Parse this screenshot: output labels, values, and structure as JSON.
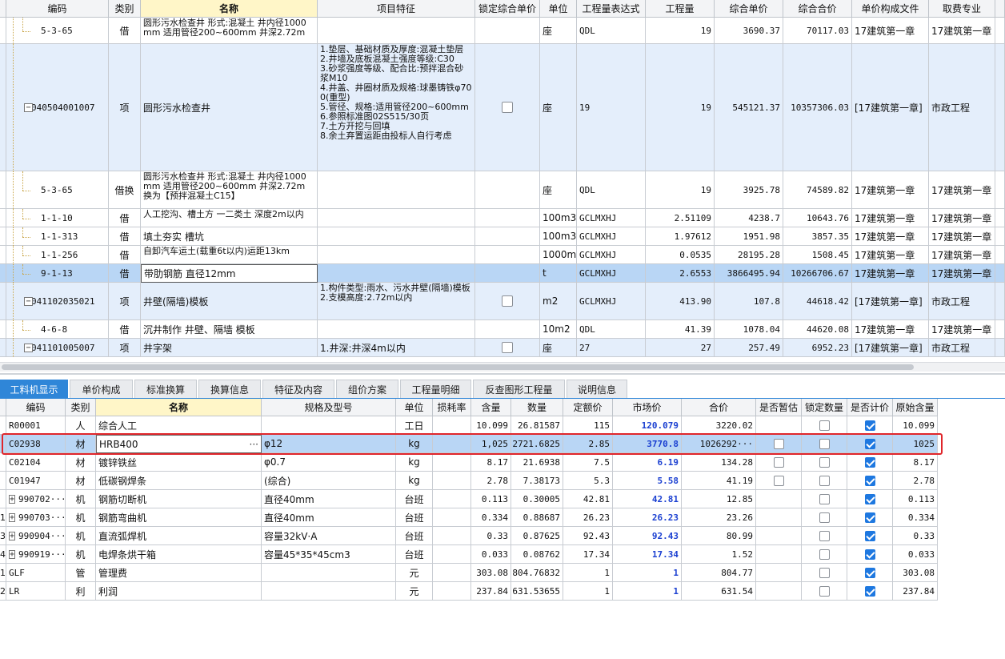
{
  "top_table": {
    "columns": [
      "编码",
      "类别",
      "名称",
      "项目特征",
      "锁定综合单价",
      "单位",
      "工程量表达式",
      "工程量",
      "综合单价",
      "综合合价",
      "单价构成文件",
      "取费专业"
    ],
    "rows": [
      {
        "code": "5-3-65",
        "type": "借",
        "name": "圆形污水检查井 形式:混凝土 井内径1000mm 适用管径200~600mm 井深2.72m",
        "feature": "",
        "lock": "",
        "unit": "座",
        "expr": "QDL",
        "qty": "19",
        "price": "3690.37",
        "total": "70117.03",
        "file": "17建筑第一章",
        "major": "17建筑第一章"
      },
      {
        "code": "040504001007",
        "type": "项",
        "name": "圆形污水检查井",
        "feature": "1.垫层、基础材质及厚度:混凝土垫层\n2.井墙及底板混凝土强度等级:C30\n3.砂浆强度等级、配合比:预拌混合砂浆M10\n4.井盖、井圈材质及规格:球墨铸铁φ700(重型)\n5.管径、规格:适用管径200~600mm\n6.参照标准图02S515/30页\n7.土方开挖与回填\n8.余土弃置运距由投标人自行考虑",
        "lock": "unchecked",
        "unit": "座",
        "expr": "19",
        "qty": "19",
        "price": "545121.37",
        "total": "10357306.03",
        "file": "[17建筑第一章]",
        "major": "市政工程"
      },
      {
        "code": "5-3-65",
        "type": "借换",
        "name": "圆形污水检查井 形式:混凝土 井内径1000mm 适用管径200~600mm 井深2.72m 换为【预拌混凝土C15】",
        "feature": "",
        "lock": "",
        "unit": "座",
        "expr": "QDL",
        "qty": "19",
        "price": "3925.78",
        "total": "74589.82",
        "file": "17建筑第一章",
        "major": "17建筑第一章"
      },
      {
        "code": "1-1-10",
        "type": "借",
        "name": "人工挖沟、槽土方 一二类土 深度2m以内",
        "feature": "",
        "lock": "",
        "unit": "100m3",
        "expr": "GCLMXHJ",
        "qty": "2.51109",
        "price": "4238.7",
        "total": "10643.76",
        "file": "17建筑第一章",
        "major": "17建筑第一章"
      },
      {
        "code": "1-1-313",
        "type": "借",
        "name": "填土夯实 槽坑",
        "feature": "",
        "lock": "",
        "unit": "100m3",
        "expr": "GCLMXHJ",
        "qty": "1.97612",
        "price": "1951.98",
        "total": "3857.35",
        "file": "17建筑第一章",
        "major": "17建筑第一章"
      },
      {
        "code": "1-1-256",
        "type": "借",
        "name": "自卸汽车运土(载重6t以内)运距13km",
        "feature": "",
        "lock": "",
        "unit": "1000m3",
        "expr": "GCLMXHJ",
        "qty": "0.0535",
        "price": "28195.28",
        "total": "1508.45",
        "file": "17建筑第一章",
        "major": "17建筑第一章"
      },
      {
        "code": "9-1-13",
        "type": "借",
        "name": "带肋钢筋 直径12mm",
        "feature": "",
        "lock": "",
        "unit": "t",
        "expr": "GCLMXHJ",
        "qty": "2.6553",
        "price": "3866495.94",
        "total": "10266706.67",
        "file": "17建筑第一章",
        "major": "17建筑第一章"
      },
      {
        "code": "041102035021",
        "type": "项",
        "name": "井壁(隔墙)模板",
        "feature": "1.构件类型:雨水、污水井壁(隔墙)模板\n2.支模高度:2.72m以内",
        "lock": "unchecked",
        "unit": "m2",
        "expr": "GCLMXHJ",
        "qty": "413.90",
        "price": "107.8",
        "total": "44618.42",
        "file": "[17建筑第一章]",
        "major": "市政工程"
      },
      {
        "code": "4-6-8",
        "type": "借",
        "name": "沉井制作 井壁、隔墙 模板",
        "feature": "",
        "lock": "",
        "unit": "10m2",
        "expr": "QDL",
        "qty": "41.39",
        "price": "1078.04",
        "total": "44620.08",
        "file": "17建筑第一章",
        "major": "17建筑第一章"
      },
      {
        "code": "041101005007",
        "type": "项",
        "name": "井字架",
        "feature": "1.井深:井深4m以内",
        "lock": "unchecked",
        "unit": "座",
        "expr": "27",
        "qty": "27",
        "price": "257.49",
        "total": "6952.23",
        "file": "[17建筑第一章]",
        "major": "市政工程"
      }
    ]
  },
  "tabs": [
    "工料机显示",
    "单价构成",
    "标准换算",
    "换算信息",
    "特征及内容",
    "组价方案",
    "工程量明细",
    "反查图形工程量",
    "说明信息"
  ],
  "bottom_table": {
    "columns": [
      "编码",
      "类别",
      "名称",
      "规格及型号",
      "单位",
      "损耗率",
      "含量",
      "数量",
      "定额价",
      "市场价",
      "合价",
      "是否暂估",
      "锁定数量",
      "是否计价",
      "原始含量"
    ],
    "rows": [
      {
        "idx": "",
        "code": "R00001",
        "type": "人",
        "name": "综合人工",
        "spec": "",
        "unit": "工日",
        "loss": "",
        "content": "10.099",
        "qty": "26.81587",
        "base": "115",
        "market": "120.079",
        "total": "3220.02",
        "est": "",
        "lockq": "unchecked",
        "priced": "checked",
        "orig": "10.099"
      },
      {
        "idx": "",
        "code": "C02938",
        "type": "材",
        "name": "HRB400",
        "spec": "φ12",
        "unit": "kg",
        "loss": "",
        "content": "1,025",
        "qty": "2721.6825",
        "base": "2.85",
        "market": "3770.8",
        "total": "1026292···",
        "est": "unchecked",
        "lockq": "unchecked",
        "priced": "checked",
        "orig": "1025"
      },
      {
        "idx": "",
        "code": "C02104",
        "type": "材",
        "name": "镀锌铁丝",
        "spec": "φ0.7",
        "unit": "kg",
        "loss": "",
        "content": "8.17",
        "qty": "21.6938",
        "base": "7.5",
        "market": "6.19",
        "total": "134.28",
        "est": "unchecked",
        "lockq": "unchecked",
        "priced": "checked",
        "orig": "8.17"
      },
      {
        "idx": "",
        "code": "C01947",
        "type": "材",
        "name": "低碳钢焊条",
        "spec": "(综合)",
        "unit": "kg",
        "loss": "",
        "content": "2.78",
        "qty": "7.38173",
        "base": "5.3",
        "market": "5.58",
        "total": "41.19",
        "est": "unchecked",
        "lockq": "unchecked",
        "priced": "checked",
        "orig": "2.78"
      },
      {
        "idx": "",
        "code": "990702···",
        "type": "机",
        "name": "钢筋切断机",
        "spec": "直径40mm",
        "unit": "台班",
        "loss": "",
        "content": "0.113",
        "qty": "0.30005",
        "base": "42.81",
        "market": "42.81",
        "total": "12.85",
        "est": "",
        "lockq": "unchecked",
        "priced": "checked",
        "orig": "0.113"
      },
      {
        "idx": "1",
        "code": "990703···",
        "type": "机",
        "name": "钢筋弯曲机",
        "spec": "直径40mm",
        "unit": "台班",
        "loss": "",
        "content": "0.334",
        "qty": "0.88687",
        "base": "26.23",
        "market": "26.23",
        "total": "23.26",
        "est": "",
        "lockq": "unchecked",
        "priced": "checked",
        "orig": "0.334"
      },
      {
        "idx": "3",
        "code": "990904···",
        "type": "机",
        "name": "直流弧焊机",
        "spec": "容量32kV·A",
        "unit": "台班",
        "loss": "",
        "content": "0.33",
        "qty": "0.87625",
        "base": "92.43",
        "market": "92.43",
        "total": "80.99",
        "est": "",
        "lockq": "unchecked",
        "priced": "checked",
        "orig": "0.33"
      },
      {
        "idx": "4",
        "code": "990919···",
        "type": "机",
        "name": "电焊条烘干箱",
        "spec": "容量45*35*45cm3",
        "unit": "台班",
        "loss": "",
        "content": "0.033",
        "qty": "0.08762",
        "base": "17.34",
        "market": "17.34",
        "total": "1.52",
        "est": "",
        "lockq": "unchecked",
        "priced": "checked",
        "orig": "0.033"
      },
      {
        "idx": "1",
        "code": "GLF",
        "type": "管",
        "name": "管理费",
        "spec": "",
        "unit": "元",
        "loss": "",
        "content": "303.08",
        "qty": "804.76832",
        "base": "1",
        "market": "1",
        "total": "804.77",
        "est": "",
        "lockq": "unchecked",
        "priced": "checked",
        "orig": "303.08"
      },
      {
        "idx": "2",
        "code": "LR",
        "type": "利",
        "name": "利润",
        "spec": "",
        "unit": "元",
        "loss": "",
        "content": "237.84",
        "qty": "631.53655",
        "base": "1",
        "market": "1",
        "total": "631.54",
        "est": "",
        "lockq": "unchecked",
        "priced": "checked",
        "orig": "237.84"
      }
    ]
  },
  "colors": {
    "selected_row": "#b9d6f5",
    "item_row": "#e4eefb",
    "highlight_border": "#e0262b",
    "tab_active": "#2f86d8",
    "market_price": "#1a3fd1"
  },
  "icons": {
    "expand": "plus-box-icon",
    "collapse": "minus-box-icon",
    "ellipsis": "ellipsis-icon"
  }
}
